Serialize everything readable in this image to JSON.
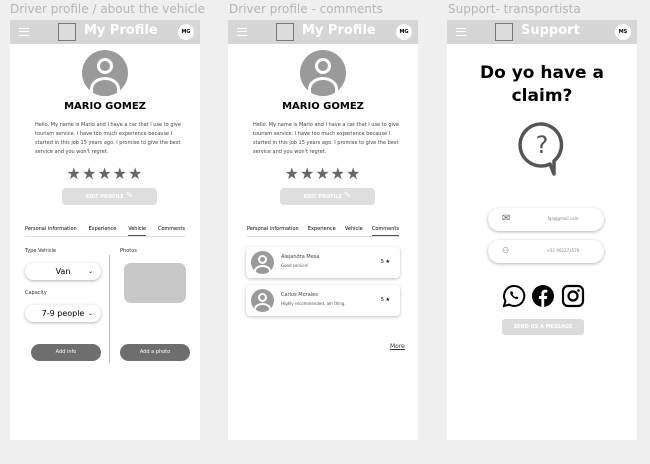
{
  "screens": [
    {
      "label": "Driver profile / about the vehicle",
      "title": "My Profile",
      "avatar": "MG",
      "name": "MARIO GOMEZ",
      "bio": "Hello. My name is Mario and I have a car that I use to give tourism service. I have too much experience because I started in this job 15 years ago. I promise to give the best service and you won't regret.",
      "stars": "★★★★★",
      "rating": 5,
      "edit": "EDIT PROFILE",
      "tabs": [
        "Personal information",
        "Experience",
        "Vehicle",
        "Comments"
      ],
      "active_tab": "Vehicle",
      "type_label": "Type Vehicle",
      "type_value": "Van",
      "capacity_label": "Capacity",
      "capacity_value": "7-9 people",
      "photos_label": "Photos",
      "add_info": "Add info",
      "add_photo": "Add a photo"
    },
    {
      "label": "Driver profile - comments",
      "title": "My Profile",
      "avatar": "MG",
      "name": "MARIO GOMEZ",
      "bio": "Hello. My name is Mario and I have a car that I use to give tourism service. I have too much experience because I started in this job 15 years ago. I promise to give the best service and you won't regret.",
      "stars": "★★★★★",
      "rating": 5,
      "edit": "EDIT PROFILE",
      "tabs": [
        "Personal information",
        "Experience",
        "Vehicle",
        "Comments"
      ],
      "active_tab": "Comments",
      "comments": [
        {
          "name": "Alejandra Mesa",
          "text": "Good service!",
          "rating": "5 ★"
        },
        {
          "name": "Carlos Morales",
          "text": "Highly recommended, am thing.",
          "rating": "5 ★"
        }
      ],
      "more": "More"
    },
    {
      "label": "Support- transportista",
      "title": "Support",
      "avatar": "MS",
      "question": "Do yo have a claim?",
      "email": "fgs@gmail.com",
      "phone": "+51 962373579",
      "send": "SEND US A MESSAGE",
      "icons": [
        "whatsapp-icon",
        "facebook-icon",
        "instagram-icon"
      ]
    }
  ]
}
